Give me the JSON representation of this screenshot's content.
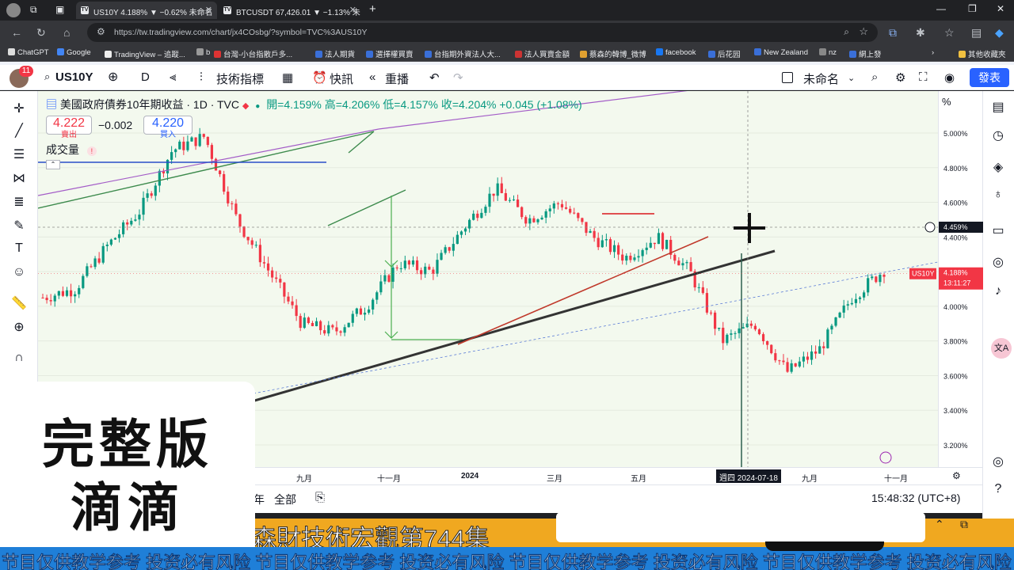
{
  "browser": {
    "tabs": [
      {
        "title": "US10Y 4.188% ▼ −0.62% 未命名"
      },
      {
        "title": "BTCUSDT 67,426.01 ▼ −1.13% 未"
      }
    ],
    "url": "https://tw.tradingview.com/chart/jx4COsbg/?symbol=TVC%3AUS10Y",
    "bookmarks": [
      "ChatGPT",
      "Google",
      "TradingView – 追蹤...",
      "b",
      "台灣-小台指散戶多...",
      "法人期貨",
      "選擇權買賣",
      "台指期外資法人大...",
      "法人買賣金額",
      "蔡森的韓博_微博",
      "facebook",
      "后花园",
      "New Zealand",
      "nz",
      "網上發",
      "其他收藏夾"
    ],
    "bookmark_more": "›"
  },
  "toolbar": {
    "badge": "11",
    "symbol": "US10Y",
    "interval": "D",
    "indicators": "技術指標",
    "alert": "快訊",
    "replay": "重播",
    "layout_name": "未命名",
    "publish": "發表"
  },
  "legend": {
    "title": "美國政府債券10年期收益 · 1D · TVC",
    "ohlc": "開=4.159% 高=4.206% 低=4.157% 收=4.204% +0.045 (+1.08%)",
    "sell_price": "4.222",
    "sell_label": "賣出",
    "spread": "−0.002",
    "buy_price": "4.220",
    "buy_label": "買入",
    "volume": "成交量"
  },
  "price_axis": {
    "unit": "%",
    "ticks": [
      "5.000%",
      "4.800%",
      "4.600%",
      "4.400%",
      "4.200%",
      "4.000%",
      "3.800%",
      "3.600%",
      "3.400%",
      "3.200%"
    ],
    "crosshair_price": "4.459%",
    "symbol_tag": "US10Y",
    "last_price": "4.188%",
    "countdown": "13:11:27"
  },
  "time_axis": {
    "ticks": [
      "九月",
      "十一月",
      "2024",
      "三月",
      "五月",
      "九月",
      "十一月"
    ],
    "crosshair_date": "週四  2024-07-18"
  },
  "bottom": {
    "range_year": "年",
    "range_all": "全部",
    "clock": "15:48:32 (UTC+8)"
  },
  "overlay": {
    "line1": "完整版",
    "line2": "滴滴",
    "episode": "森財技術宏觀第744集",
    "banner": "节目仅供教学参考  投资必有风险  节目仅供教学参考  投资必有风险  节目仅供教学参考  投资必有风险  节目仅供教学参考  投资必有风险"
  },
  "colors": {
    "up": "#089981",
    "down": "#f23645",
    "accent": "#2962ff",
    "chart_bg": "#f3f9ee"
  },
  "chart_data": {
    "type": "candlestick",
    "title": "美國政府債券10年期收益 · 1D · TVC",
    "ylim": [
      3.1,
      5.1
    ],
    "unit": "%",
    "x_labels": [
      "九月",
      "十一月",
      "2024",
      "三月",
      "五月",
      "九月",
      "十一月"
    ],
    "approx_close_path": [
      4.05,
      4.1,
      4.35,
      4.55,
      4.9,
      4.98,
      4.5,
      4.2,
      3.9,
      3.85,
      4.0,
      4.25,
      4.2,
      4.45,
      4.68,
      4.5,
      4.6,
      4.4,
      4.28,
      4.4,
      4.2,
      3.8,
      3.9,
      3.62,
      3.75,
      4.05,
      4.21
    ],
    "last": 4.188
  }
}
